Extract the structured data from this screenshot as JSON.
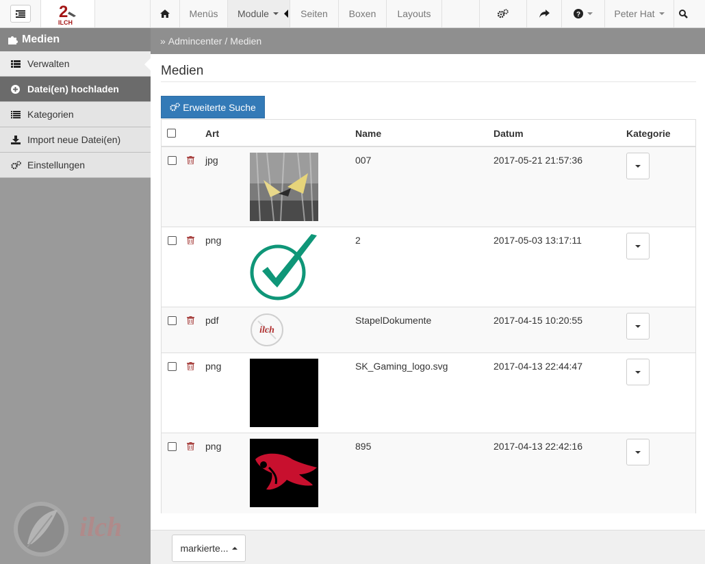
{
  "navbar": {
    "logo_number": "2",
    "logo_text": "ILCH",
    "items": [
      {
        "label": "Menüs"
      },
      {
        "label": "Module"
      },
      {
        "label": "Seiten"
      },
      {
        "label": "Boxen"
      },
      {
        "label": "Layouts"
      }
    ],
    "user": "Peter Hat"
  },
  "sidebar": {
    "title": "Medien",
    "items": [
      {
        "label": "Verwalten"
      },
      {
        "label": "Datei(en) hochladen"
      },
      {
        "label": "Kategorien"
      },
      {
        "label": "Import neue Datei(en)"
      },
      {
        "label": "Einstellungen"
      }
    ],
    "logo_text": "ilch"
  },
  "breadcrumb": {
    "prefix": "»",
    "items": [
      "Admincenter",
      "/",
      "Medien"
    ]
  },
  "page": {
    "title": "Medien",
    "search_button": "Erweiterte Suche"
  },
  "table": {
    "headers": {
      "type": "Art",
      "name": "Name",
      "date": "Datum",
      "category": "Kategorie"
    },
    "rows": [
      {
        "type": "jpg",
        "name": "007",
        "date": "2017-05-21 21:57:36",
        "thumb": "butterfly"
      },
      {
        "type": "png",
        "name": "2",
        "date": "2017-05-03 13:17:11",
        "thumb": "checkmark"
      },
      {
        "type": "pdf",
        "name": "StapelDokumente",
        "date": "2017-04-15 10:20:55",
        "thumb": "ilch-pdf"
      },
      {
        "type": "png",
        "name": "SK_Gaming_logo.svg",
        "date": "2017-04-13 22:44:47",
        "thumb": "black"
      },
      {
        "type": "png",
        "name": "895",
        "date": "2017-04-13 22:42:16",
        "thumb": "red-mascot"
      }
    ]
  },
  "footer": {
    "marked_button": "markierte..."
  },
  "colors": {
    "primary": "#337ab7",
    "sidebar_bg": "#9a9a9a",
    "trash": "#a94442",
    "check_green": "#0f9678",
    "mascot_red": "#c8102e"
  }
}
